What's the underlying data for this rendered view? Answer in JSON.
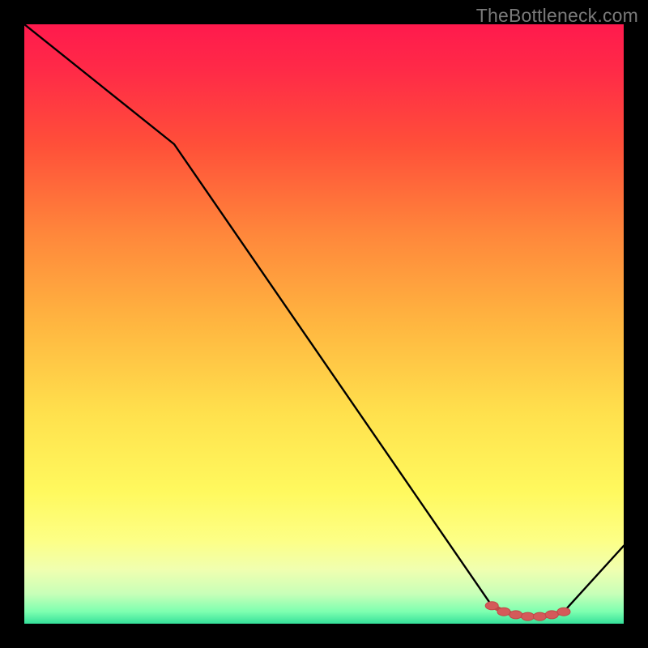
{
  "watermark": "TheBottleneck.com",
  "colors": {
    "background": "#000000",
    "line": "#000000",
    "marker_fill": "#d45a5a",
    "marker_stroke": "#c24848",
    "gradient_stops": [
      {
        "offset": 0.0,
        "color": "#ff1a4d"
      },
      {
        "offset": 0.08,
        "color": "#ff2b47"
      },
      {
        "offset": 0.2,
        "color": "#ff4f39"
      },
      {
        "offset": 0.35,
        "color": "#ff873b"
      },
      {
        "offset": 0.5,
        "color": "#ffb640"
      },
      {
        "offset": 0.65,
        "color": "#ffe14d"
      },
      {
        "offset": 0.78,
        "color": "#fff95e"
      },
      {
        "offset": 0.86,
        "color": "#fdff85"
      },
      {
        "offset": 0.91,
        "color": "#f0ffb0"
      },
      {
        "offset": 0.95,
        "color": "#c8ffb8"
      },
      {
        "offset": 0.98,
        "color": "#7dffb0"
      },
      {
        "offset": 1.0,
        "color": "#35e09a"
      }
    ]
  },
  "chart_data": {
    "type": "line",
    "title": "",
    "xlabel": "",
    "ylabel": "",
    "xlim": [
      0,
      100
    ],
    "ylim": [
      0,
      100
    ],
    "x": [
      0,
      25,
      78,
      80,
      82,
      84,
      86,
      88,
      90,
      100
    ],
    "values": [
      100,
      80,
      3,
      2,
      1.5,
      1.2,
      1.2,
      1.5,
      2,
      13
    ],
    "markers": {
      "x": [
        78,
        80,
        82,
        84,
        86,
        88,
        90
      ],
      "values": [
        3,
        2,
        1.5,
        1.2,
        1.2,
        1.5,
        2
      ]
    }
  }
}
